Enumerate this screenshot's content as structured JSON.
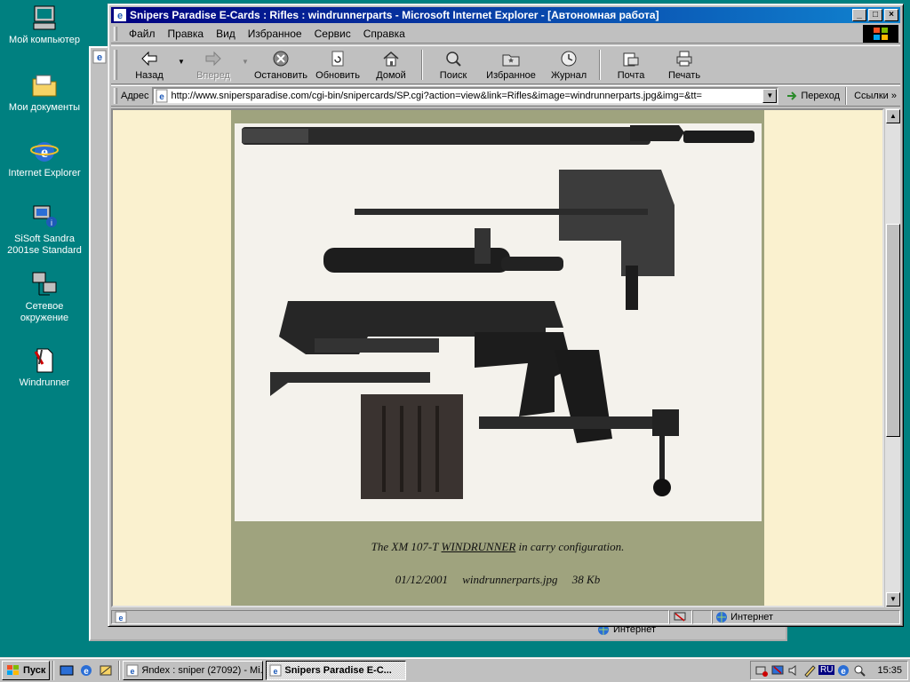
{
  "desktop": {
    "icons": [
      {
        "label": "Мой компьютер"
      },
      {
        "label": "Мои документы"
      },
      {
        "label": "Internet Explorer"
      },
      {
        "label": "SiSoft Sandra 2001se Standard"
      },
      {
        "label": "Сетевое окружение"
      },
      {
        "label": "Windrunner"
      }
    ]
  },
  "window": {
    "title": "Snipers Paradise E-Cards : Rifles : windrunnerparts - Microsoft Internet Explorer - [Автономная работа]",
    "buttons": {
      "minimize": "_",
      "maximize": "□",
      "close": "×"
    }
  },
  "menu": {
    "items": [
      {
        "label": "Файл"
      },
      {
        "label": "Правка"
      },
      {
        "label": "Вид"
      },
      {
        "label": "Избранное"
      },
      {
        "label": "Сервис"
      },
      {
        "label": "Справка"
      }
    ]
  },
  "toolbar": {
    "back": "Назад",
    "forward": "Вперед",
    "stop": "Остановить",
    "refresh": "Обновить",
    "home": "Домой",
    "search": "Поиск",
    "favorites": "Избранное",
    "history": "Журнал",
    "mail": "Почта",
    "print": "Печать"
  },
  "address": {
    "label": "Адрес",
    "url": "http://www.snipersparadise.com/cgi-bin/snipercards/SP.cgi?action=view&link=Rifles&image=windrunnerparts.jpg&img=&tt=",
    "go": "Переход",
    "links": "Ссылки",
    "links_more": "»"
  },
  "page": {
    "caption_prefix": "The XM 107-T ",
    "caption_link": "WINDRUNNER",
    "caption_suffix": " in carry configuration.",
    "date": "01/12/2001",
    "filename": "windrunnerparts.jpg",
    "size": "38 Kb"
  },
  "status": {
    "zone": "Интернет"
  },
  "bgwindow": {
    "status_zone": "Интернет"
  },
  "taskbar": {
    "start": "Пуск",
    "tasks": [
      {
        "label": "Яndex : sniper (27092) - Mi..."
      },
      {
        "label": "Snipers Paradise E-C..."
      }
    ],
    "tray_lang": "RU",
    "clock": "15:35"
  },
  "colors": {
    "desktop": "#008080",
    "titlebar": "#000080",
    "page_bg": "#faf1cf",
    "page_frame": "#9fa37e"
  }
}
